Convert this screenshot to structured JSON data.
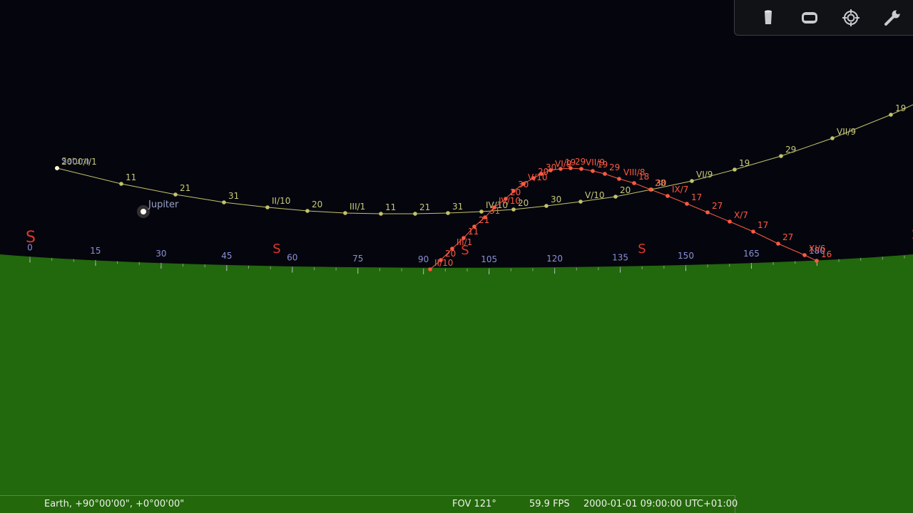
{
  "sky": {
    "ground_color": "#22680c",
    "sky_color": "#05060d",
    "cardinal_color": "#e0362a",
    "azimuth_color": "#8b8fd8",
    "cardinals": [
      {
        "label": "S",
        "az": 0
      },
      {
        "label": "S",
        "az": 45
      },
      {
        "label": "S",
        "az": 90
      },
      {
        "label": "S",
        "az": 135
      },
      {
        "label": "S",
        "az": 180
      }
    ],
    "azimuth_labels": [
      "0",
      "15",
      "30",
      "45",
      "60",
      "75",
      "90",
      "105",
      "120",
      "135",
      "150",
      "165",
      "180"
    ],
    "jupiter_label": "Jupiter",
    "saturn_label": "Saturn"
  },
  "tracks": {
    "saturn_color": "#c4c46a",
    "saturn_label_color": "#c8c87a",
    "mars_color": "#ff5a42",
    "saturn_points": [
      {
        "t": "2000/I/1"
      },
      {
        "t": "11"
      },
      {
        "t": "21"
      },
      {
        "t": "31"
      },
      {
        "t": "II/10"
      },
      {
        "t": "20"
      },
      {
        "t": "III/1"
      },
      {
        "t": "11"
      },
      {
        "t": "21"
      },
      {
        "t": "31"
      },
      {
        "t": "IV/10"
      },
      {
        "t": "20"
      },
      {
        "t": "30"
      },
      {
        "t": "V/10"
      },
      {
        "t": "20"
      },
      {
        "t": "30"
      },
      {
        "t": "VI/9"
      },
      {
        "t": "19"
      },
      {
        "t": "29"
      },
      {
        "t": "VII/9"
      },
      {
        "t": "19"
      }
    ],
    "mars_points": [
      {
        "t": "II/10"
      },
      {
        "t": "20"
      },
      {
        "t": "III/1"
      },
      {
        "t": "11"
      },
      {
        "t": "21"
      },
      {
        "t": "31"
      },
      {
        "t": "IV/10"
      },
      {
        "t": "20"
      },
      {
        "t": "30"
      },
      {
        "t": "V/10"
      },
      {
        "t": "20"
      },
      {
        "t": "30"
      },
      {
        "t": "VI/9"
      },
      {
        "t": "19"
      },
      {
        "t": "29"
      },
      {
        "t": "VII/9"
      },
      {
        "t": "19"
      },
      {
        "t": "29"
      },
      {
        "t": "VIII/8"
      },
      {
        "t": "18"
      },
      {
        "t": "28"
      },
      {
        "t": "IX/7"
      },
      {
        "t": "17"
      },
      {
        "t": "27"
      },
      {
        "t": "X/7"
      },
      {
        "t": "17"
      },
      {
        "t": "27"
      },
      {
        "t": "XI/6"
      },
      {
        "t": "16"
      }
    ]
  },
  "toolbar": {
    "items": [
      {
        "icon": "telescope-icon"
      },
      {
        "icon": "ocular-view-icon"
      },
      {
        "icon": "target-crosshair-icon"
      },
      {
        "icon": "wrench-settings-icon"
      }
    ]
  },
  "status": {
    "location": "Earth, +90°00'00\", +0°00'00\"",
    "fov": "FOV 121°",
    "fps": "59.9 FPS",
    "datetime": "2000-01-01 09:00:00 UTC+01:00"
  }
}
